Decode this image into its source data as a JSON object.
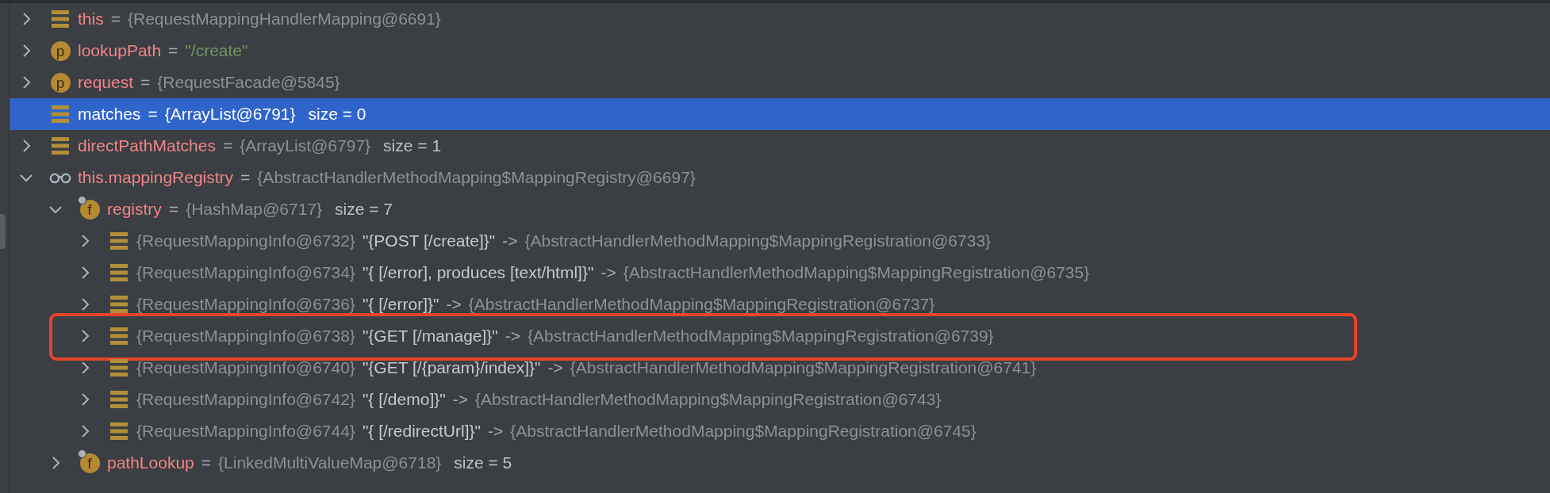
{
  "variables": [
    {
      "kind": "variable",
      "name": "this",
      "separator": "=",
      "value": "{RequestMappingHandlerMapping@6691}",
      "string_value": false,
      "expandable": true,
      "expanded": false,
      "selected": false,
      "marked": false
    },
    {
      "kind": "param",
      "icon_letter": "p",
      "name": "lookupPath",
      "separator": "=",
      "value": "\"/create\"",
      "string_value": true,
      "expandable": true,
      "expanded": false,
      "selected": false,
      "marked": false
    },
    {
      "kind": "param",
      "icon_letter": "p",
      "name": "request",
      "separator": "=",
      "value": "{RequestFacade@5845}",
      "string_value": false,
      "expandable": true,
      "expanded": false,
      "selected": false,
      "marked": false
    },
    {
      "kind": "variable",
      "name": "matches",
      "separator": "=",
      "value": "{ArrayList@6791}",
      "size": "size = 0",
      "string_value": false,
      "expandable": false,
      "expanded": false,
      "selected": true,
      "marked": false
    },
    {
      "kind": "variable",
      "name": "directPathMatches",
      "separator": "=",
      "value": "{ArrayList@6797}",
      "size": "size = 1",
      "string_value": false,
      "expandable": true,
      "expanded": false,
      "selected": false,
      "marked": false
    },
    {
      "kind": "watch",
      "name": "this.mappingRegistry",
      "separator": "=",
      "value": "{AbstractHandlerMethodMapping$MappingRegistry@6697}",
      "string_value": false,
      "expandable": true,
      "expanded": true,
      "selected": false,
      "marked": false,
      "children": [
        {
          "kind": "field",
          "icon_letter": "f",
          "name": "registry",
          "separator": "=",
          "value": "{HashMap@6717}",
          "size": "size = 7",
          "string_value": false,
          "expandable": true,
          "expanded": true,
          "selected": false,
          "marked": false,
          "children": [
            {
              "kind": "variable",
              "key": "{RequestMappingInfo@6732}",
              "label": "\"{POST [/create]}\"",
              "separator": "->",
              "value": "{AbstractHandlerMethodMapping$MappingRegistration@6733}",
              "string_value": false,
              "expandable": true,
              "expanded": false,
              "selected": false,
              "marked": false
            },
            {
              "kind": "variable",
              "key": "{RequestMappingInfo@6734}",
              "label": "\"{ [/error], produces [text/html]}\"",
              "separator": "->",
              "value": "{AbstractHandlerMethodMapping$MappingRegistration@6735}",
              "string_value": false,
              "expandable": true,
              "expanded": false,
              "selected": false,
              "marked": false
            },
            {
              "kind": "variable",
              "key": "{RequestMappingInfo@6736}",
              "label": "\"{ [/error]}\"",
              "separator": "->",
              "value": "{AbstractHandlerMethodMapping$MappingRegistration@6737}",
              "string_value": false,
              "expandable": true,
              "expanded": false,
              "selected": false,
              "marked": false
            },
            {
              "kind": "variable",
              "key": "{RequestMappingInfo@6738}",
              "label": "\"{GET [/manage]}\"",
              "separator": "->",
              "value": "{AbstractHandlerMethodMapping$MappingRegistration@6739}",
              "string_value": false,
              "expandable": true,
              "expanded": false,
              "selected": false,
              "marked": true
            },
            {
              "kind": "variable",
              "key": "{RequestMappingInfo@6740}",
              "label": "\"{GET [/{param}/index]}\"",
              "separator": "->",
              "value": "{AbstractHandlerMethodMapping$MappingRegistration@6741}",
              "string_value": false,
              "expandable": true,
              "expanded": false,
              "selected": false,
              "marked": false
            },
            {
              "kind": "variable",
              "key": "{RequestMappingInfo@6742}",
              "label": "\"{ [/demo]}\"",
              "separator": "->",
              "value": "{AbstractHandlerMethodMapping$MappingRegistration@6743}",
              "string_value": false,
              "expandable": true,
              "expanded": false,
              "selected": false,
              "marked": false
            },
            {
              "kind": "variable",
              "key": "{RequestMappingInfo@6744}",
              "label": "\"{ [/redirectUrl]}\"",
              "separator": "->",
              "value": "{AbstractHandlerMethodMapping$MappingRegistration@6745}",
              "string_value": false,
              "expandable": true,
              "expanded": false,
              "selected": false,
              "marked": false
            }
          ]
        },
        {
          "kind": "field",
          "icon_letter": "f",
          "name": "pathLookup",
          "separator": "=",
          "value": "{LinkedMultiValueMap@6718}",
          "size": "size = 5",
          "string_value": false,
          "expandable": true,
          "expanded": false,
          "selected": false,
          "marked": false
        }
      ]
    }
  ]
}
